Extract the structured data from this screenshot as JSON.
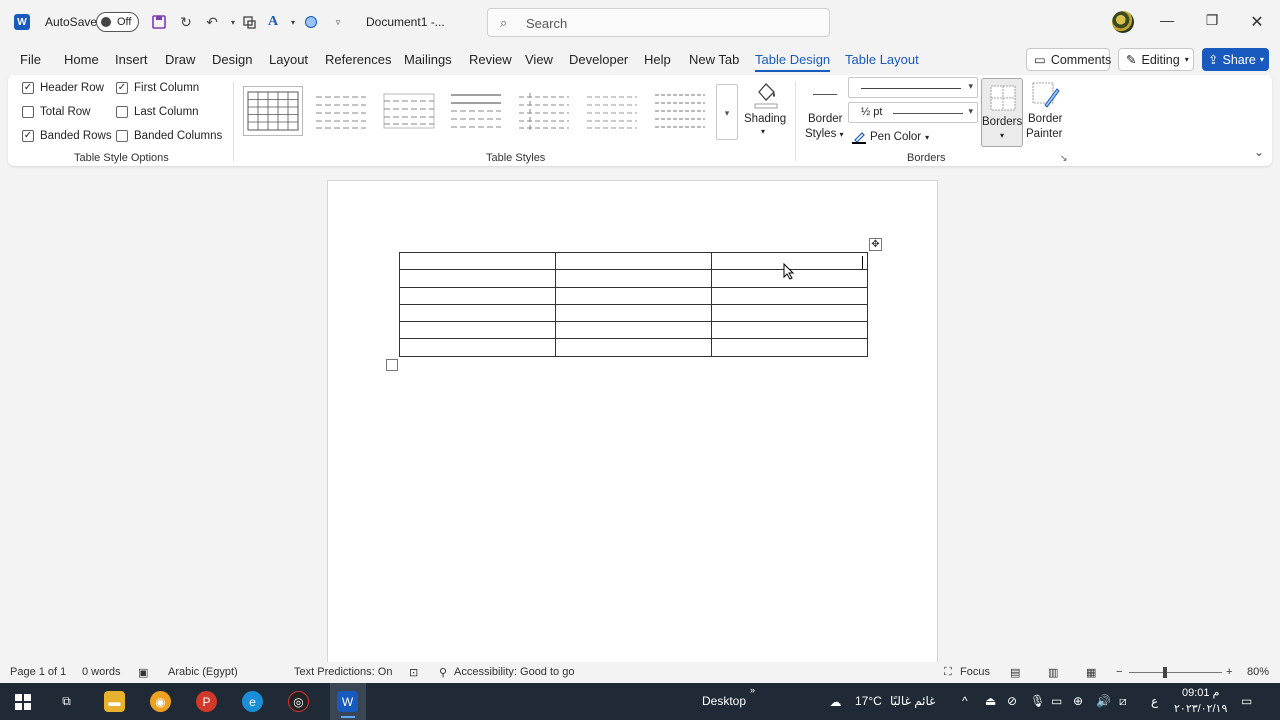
{
  "titlebar": {
    "app_logo": "W",
    "autosave_label": "AutoSave",
    "autosave_state": "Off",
    "doc_title": "Document1  -...",
    "search_placeholder": "Search"
  },
  "tabs": [
    {
      "label": "File"
    },
    {
      "label": "Home"
    },
    {
      "label": "Insert"
    },
    {
      "label": "Draw"
    },
    {
      "label": "Design"
    },
    {
      "label": "Layout"
    },
    {
      "label": "References"
    },
    {
      "label": "Mailings"
    },
    {
      "label": "Review"
    },
    {
      "label": "View"
    },
    {
      "label": "Developer"
    },
    {
      "label": "Help"
    },
    {
      "label": "New Tab"
    },
    {
      "label": "Table Design"
    },
    {
      "label": "Table Layout"
    }
  ],
  "actions": {
    "comments": "Comments",
    "editing": "Editing",
    "share": "Share"
  },
  "ribbon": {
    "options": {
      "header_row": "Header Row",
      "total_row": "Total Row",
      "banded_rows": "Banded Rows",
      "first_column": "First Column",
      "last_column": "Last Column",
      "banded_columns": "Banded Columns",
      "group_label": "Table Style Options"
    },
    "styles": {
      "group_label": "Table Styles",
      "shading": "Shading"
    },
    "borders": {
      "border_styles_1": "Border",
      "border_styles_2": "Styles",
      "weight": "½ pt",
      "pen_color": "Pen Color",
      "borders": "Borders",
      "border_painter_1": "Border",
      "border_painter_2": "Painter",
      "group_label": "Borders"
    }
  },
  "statusbar": {
    "page": "Page 1 of 1",
    "words": "0 words",
    "language": "Arabic (Egypt)",
    "text_predictions": "Text Predictions: On",
    "accessibility": "Accessibility: Good to go",
    "focus": "Focus",
    "zoom": "80%"
  },
  "taskbar": {
    "desktop": "Desktop",
    "weather_temp": "17°C",
    "weather_text": "غائم غالبًا",
    "lang": "ع",
    "time": "09:01 م",
    "date": "٢٠٢٣/٠٢/١٩"
  },
  "colors": {
    "accent": "#185abd",
    "taskbar": "#1f2a36"
  }
}
